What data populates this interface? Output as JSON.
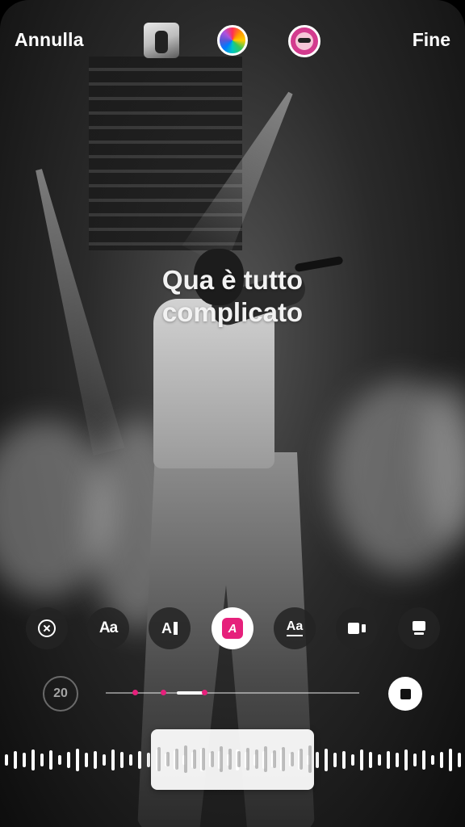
{
  "topbar": {
    "cancel_label": "Annulla",
    "done_label": "Fine",
    "album_thumbnail_icon": "album-cover-thumbnail",
    "color_picker_icon": "color-wheel-icon",
    "avatar_icon": "avatar-sticker-icon"
  },
  "lyric": {
    "line1": "Qua è tutto",
    "line2": "complicato"
  },
  "style_toolbar": {
    "items": [
      {
        "icon": "close-circle-icon"
      },
      {
        "icon": "text-size-icon",
        "label": "Aa"
      },
      {
        "icon": "text-cursor-icon",
        "label": "A"
      },
      {
        "icon": "highlight-a-icon",
        "label": "A",
        "selected": true
      },
      {
        "icon": "underline-aa-icon",
        "label": "Aa"
      },
      {
        "icon": "camera-layout-icon"
      },
      {
        "icon": "card-layout-icon"
      }
    ],
    "accent_color": "#e6207b"
  },
  "timeline": {
    "duration_label": "20",
    "progress_markers": 3,
    "stop_icon": "stop-icon"
  },
  "colors": {
    "accent": "#e6207b",
    "text": "#ffffff"
  }
}
